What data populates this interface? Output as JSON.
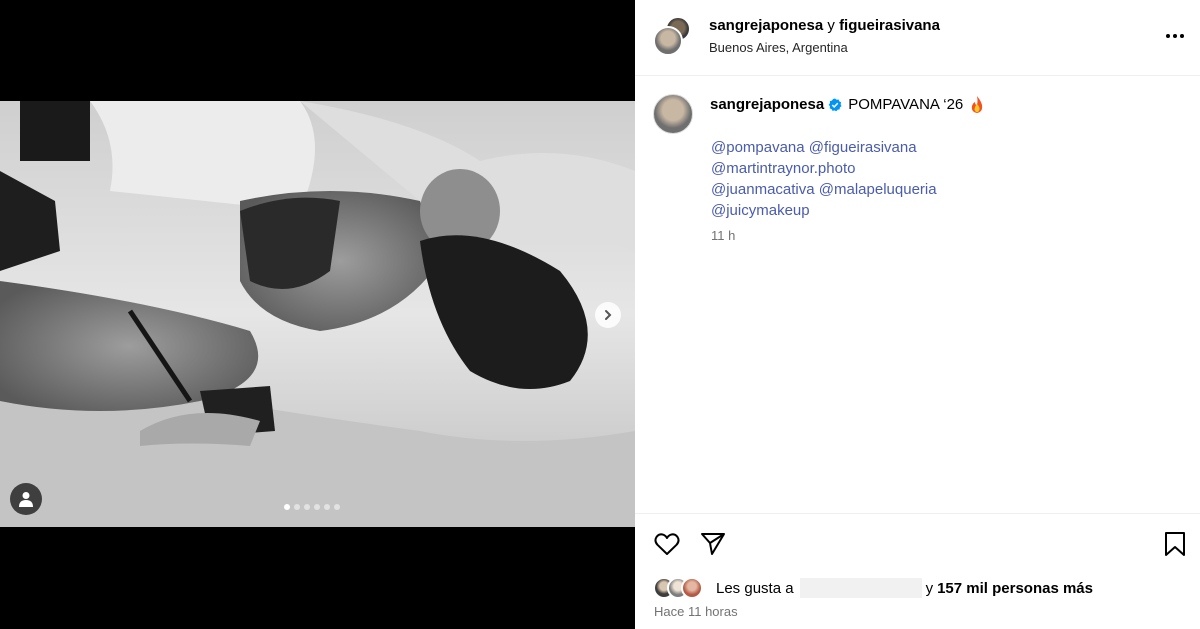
{
  "post": {
    "header": {
      "author": "sangrejaponesa",
      "connector": "y",
      "collaborator": "figueirasivana",
      "location": "Buenos Aires, Argentina"
    },
    "caption": {
      "author": "sangrejaponesa",
      "text": "POMPAVANA ‘26",
      "mentions": [
        "@pompavana",
        "@figueirasivana",
        "@martintraynor.photo",
        "@juanmacativa",
        "@malapeluqueria",
        "@juicymakeup"
      ],
      "relative_time": "11 h"
    },
    "carousel": {
      "current_index": 1,
      "total": 6
    },
    "likes": {
      "prefix": "Les gusta a",
      "connector": "y",
      "count_text": "157 mil personas más"
    },
    "posted": "Hace 11 horas"
  },
  "icons": {
    "more": "more-horizontal-icon",
    "verified": "verified-badge-icon",
    "fire": "fire-emoji-icon",
    "like": "heart-icon",
    "share": "send-icon",
    "save": "bookmark-icon",
    "next": "chevron-right-icon",
    "tagged_users": "user-icon"
  },
  "colors": {
    "link": "#4a5cad",
    "verified": "#0095f6",
    "secondary_text": "#737373",
    "divider": "#efefef"
  }
}
